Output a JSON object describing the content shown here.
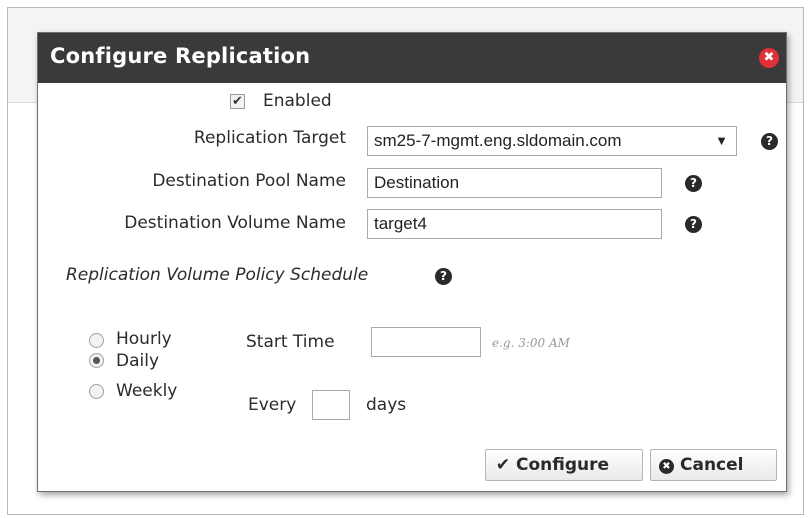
{
  "dialog": {
    "title": "Configure Replication",
    "close_icon": "close-icon"
  },
  "enabled": {
    "label": "Enabled",
    "checked": true
  },
  "replication_target": {
    "label": "Replication Target",
    "value": "sm25-7-mgmt.eng.sldomain.com",
    "arrow": "▼"
  },
  "destination_pool": {
    "label": "Destination Pool Name",
    "value": "Destination"
  },
  "destination_volume": {
    "label": "Destination Volume Name",
    "value": "target4"
  },
  "schedule": {
    "heading": "Replication Volume Policy Schedule",
    "options": [
      {
        "label": "Hourly",
        "selected": false
      },
      {
        "label": "Daily",
        "selected": true
      },
      {
        "label": "Weekly",
        "selected": false
      }
    ],
    "start_time_label": "Start Time",
    "start_time_value": "",
    "start_time_hint": "e.g. 3:00 AM",
    "every_label": "Every",
    "every_value": "",
    "days_label": "days"
  },
  "help_glyph": "?",
  "buttons": {
    "configure": "Configure",
    "cancel": "Cancel"
  },
  "icons": {
    "check": "✔",
    "x": "✖"
  }
}
